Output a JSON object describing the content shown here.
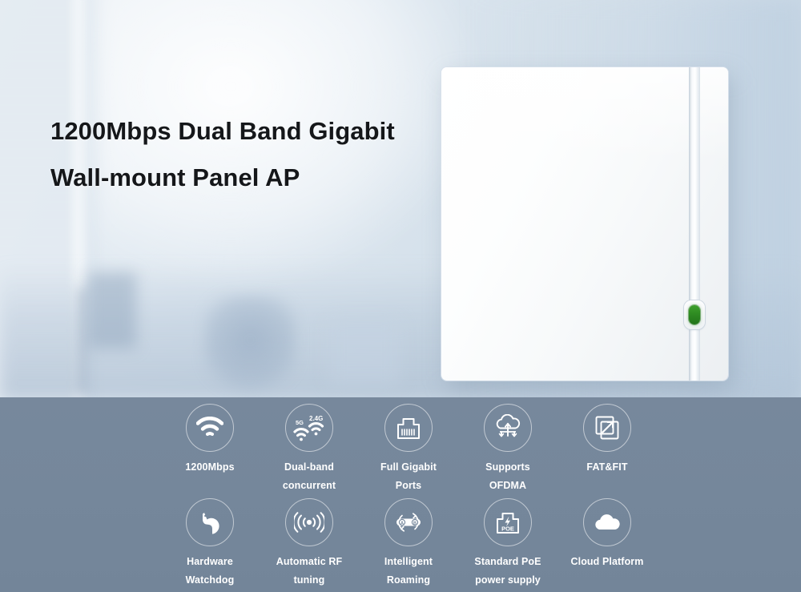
{
  "hero": {
    "headline_line1": "1200Mbps Dual Band Gigabit",
    "headline_line2": "Wall-mount Panel AP",
    "headline_color": "#15171a",
    "background_description": "blurred office interior with window blinds"
  },
  "device": {
    "name": "wall-mount-panel-ap",
    "body_color": "#ffffff",
    "led_color": "#2f8b22",
    "led_state": "on"
  },
  "features": {
    "band_color": "#75879b",
    "label_color": "#ffffff",
    "items": [
      {
        "icon": "wifi-signal-icon",
        "label": "1200Mbps"
      },
      {
        "icon": "dual-band-wifi-icon",
        "label": "Dual-band\nconcurrent",
        "badge_5g": "5G",
        "badge_24g": "2.4G"
      },
      {
        "icon": "rj45-port-icon",
        "label": "Full Gigabit\nPorts"
      },
      {
        "icon": "cloud-ofdma-icon",
        "label": "Supports\nOFDMA"
      },
      {
        "icon": "fat-fit-switch-icon",
        "label": "FAT&FIT"
      },
      {
        "icon": "watchdog-dog-icon",
        "label": "Hardware\nWatchdog"
      },
      {
        "icon": "rf-tuning-waves-icon",
        "label": "Automatic RF\ntuning"
      },
      {
        "icon": "roaming-ab-icon",
        "label": "Intelligent\nRoaming",
        "badge_a": "A",
        "badge_b": "B"
      },
      {
        "icon": "poe-power-icon",
        "label": "Standard PoE\npower supply",
        "badge_poe": "POE"
      },
      {
        "icon": "cloud-platform-icon",
        "label": "Cloud Platform"
      }
    ]
  }
}
